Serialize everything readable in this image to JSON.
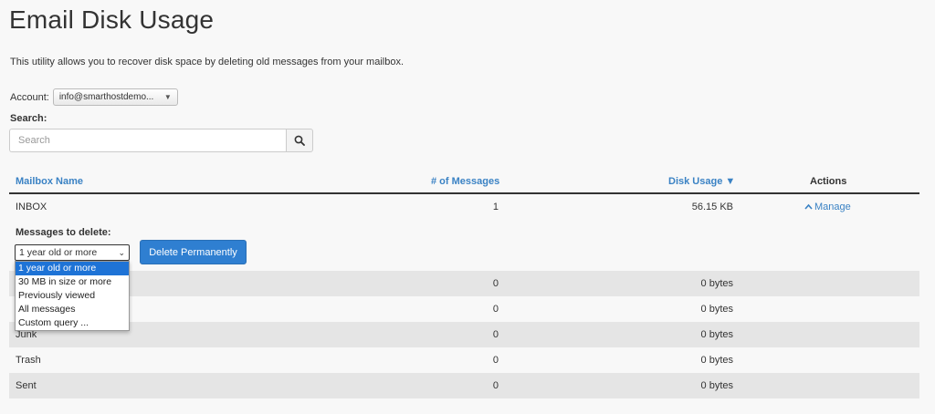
{
  "page": {
    "title": "Email Disk Usage",
    "description": "This utility allows you to recover disk space by deleting old messages from your mailbox."
  },
  "account": {
    "label": "Account:",
    "selected": "info@smarthostdemo..."
  },
  "search": {
    "label": "Search:",
    "placeholder": "Search"
  },
  "table": {
    "headers": {
      "name": "Mailbox Name",
      "count": "# of Messages",
      "usage": "Disk Usage ▼",
      "actions": "Actions"
    },
    "inbox": {
      "name": "INBOX",
      "count": "1",
      "usage": "56.15 KB",
      "action": "Manage"
    },
    "rows": [
      {
        "name": "",
        "count": "0",
        "usage": "0 bytes"
      },
      {
        "name": "",
        "count": "0",
        "usage": "0 bytes"
      },
      {
        "name": "Junk",
        "count": "0",
        "usage": "0 bytes"
      },
      {
        "name": "Trash",
        "count": "0",
        "usage": "0 bytes"
      },
      {
        "name": "Sent",
        "count": "0",
        "usage": "0 bytes"
      }
    ]
  },
  "manage": {
    "messages_label": "Messages to delete:",
    "selected": "1 year old or more",
    "options": [
      "1 year old or more",
      "30 MB in size or more",
      "Previously viewed",
      "All messages",
      "Custom query ..."
    ],
    "delete_label": "Delete Permanently"
  },
  "colors": {
    "accent": "#3a82c4",
    "primary_button": "#2f7fd1",
    "selected_option": "#1e73d6",
    "row_shade": "#e5e5e5"
  },
  "icons": {
    "search": "search-icon",
    "manage": "chevron-up-icon",
    "account_caret": "caret-down-icon"
  }
}
